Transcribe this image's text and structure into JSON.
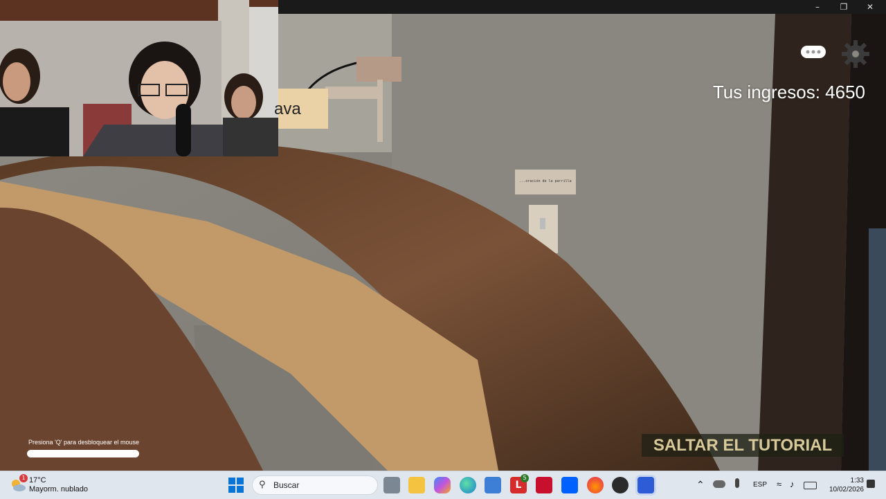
{
  "window": {
    "minimize_icon": "minimize-icon",
    "maximize_icon": "restore-icon",
    "close_icon": "close-icon"
  },
  "game": {
    "partial_label": "ava",
    "sign_text": "...oración de la parrilla",
    "income_label": "Tus ingresos: 4650",
    "skip_tutorial": "SALTAR EL TUTORIAL",
    "mouse_hint": "Presiona 'Q' para desbloquear el mouse",
    "icons": [
      "chat-icon",
      "settings-gear-icon"
    ]
  },
  "taskbar": {
    "weather": {
      "temperature": "17°C",
      "description": "Mayorm. nublado",
      "badge": "1"
    },
    "search_placeholder": "Buscar",
    "pinned_apps": [
      "windows-start-icon",
      "task-view-icon",
      "file-explorer-icon",
      "copilot-icon",
      "edge-icon",
      "store-icon",
      "app-l-icon",
      "mcafee-icon",
      "dropbox-icon",
      "firefox-icon",
      "obs-icon",
      "roblox-icon"
    ],
    "app_badge": "5",
    "tray": {
      "language": "ESP",
      "time": "1:33",
      "date": "10/02/2026"
    },
    "colors": {
      "taskbar_bg": "#dfe6ee",
      "accent": "#0067c0"
    }
  }
}
